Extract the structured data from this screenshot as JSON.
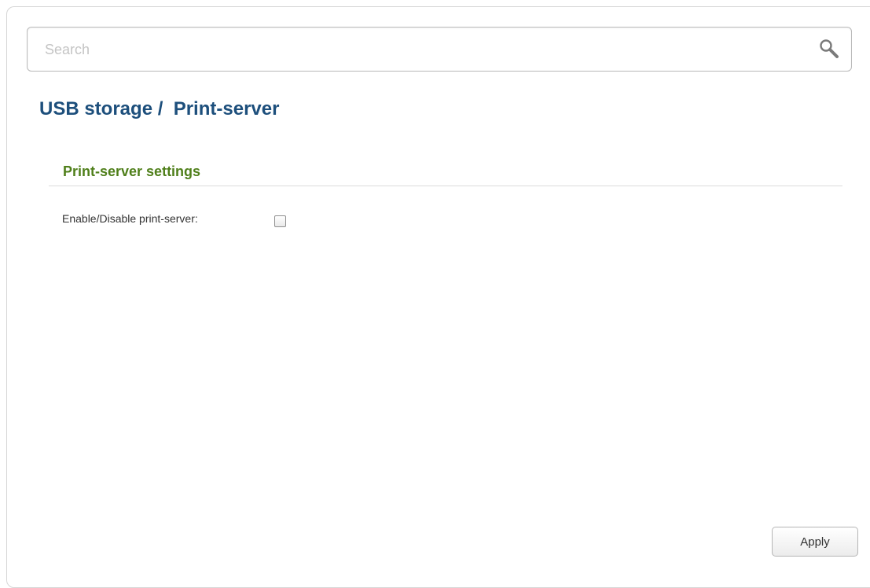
{
  "search": {
    "placeholder": "Search",
    "value": "",
    "icon": "search-icon"
  },
  "header": {
    "title": "USB storage /  Print-server"
  },
  "section": {
    "title": "Print-server settings"
  },
  "fields": {
    "print_server": {
      "label": "Enable/Disable print-server:",
      "checked": false
    }
  },
  "actions": {
    "apply_label": "Apply"
  },
  "colors": {
    "title": "#1d4f7c",
    "section_title": "#4f7f1a",
    "text": "#333333",
    "placeholder": "#c4c4c4"
  }
}
